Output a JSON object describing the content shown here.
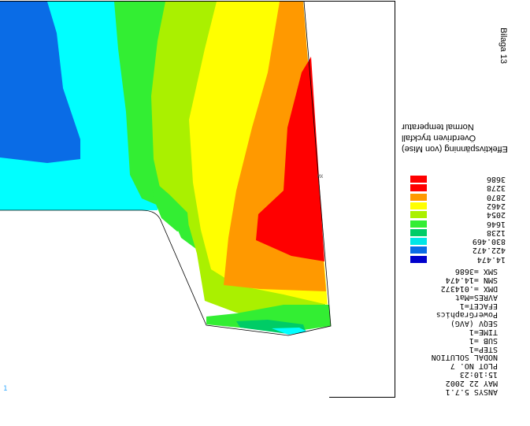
{
  "page_label": "Bilaga 13",
  "titles": [
    "Effektivspänning (von Mise)",
    "Överdriven tryckfall",
    "Normal temperatur"
  ],
  "info_lines": [
    "ANSYS 5.7.1",
    "MAY 22 2002",
    "15:10:23",
    "PLOT NO.   7",
    "NODAL SOLUTION",
    "STEP=1",
    "SUB =1",
    "TIME=1",
    "SEQV     (AVG)",
    "PowerGraphics",
    "EFACET=1",
    "AVRES=Mat",
    "DMX =.014372",
    "SMN =14.474",
    "SMX =3686"
  ],
  "legend": [
    {
      "value": "14.474",
      "color": "#0000cc"
    },
    {
      "value": "422.472",
      "color": "#0a6ce6"
    },
    {
      "value": "830.469",
      "color": "#00e6e6"
    },
    {
      "value": "1238",
      "color": "#00cc66"
    },
    {
      "value": "1646",
      "color": "#33ee33"
    },
    {
      "value": "2054",
      "color": "#aaf000"
    },
    {
      "value": "2462",
      "color": "#ffff00"
    },
    {
      "value": "2870",
      "color": "#ff9900"
    },
    {
      "value": "3278",
      "color": "#ff0000"
    },
    {
      "value": "3686",
      "color": "#ff0000"
    }
  ],
  "triad_label": "1",
  "node_label": "MX",
  "colors": {
    "blue": "#0a6ce6",
    "cyan": "#00ffff",
    "green": "#33ee33",
    "light_green": "#aaf000",
    "yellow": "#ffff00",
    "orange": "#ff9900",
    "red": "#ff0000",
    "teal": "#00cc66"
  }
}
